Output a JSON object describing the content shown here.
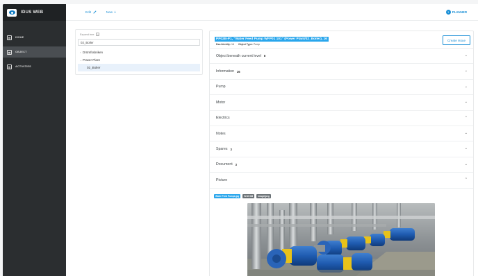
{
  "app": {
    "name": "IDUS WEB"
  },
  "sidebar": {
    "items": [
      {
        "label": "ISSUE",
        "icon": "document-icon",
        "active": false
      },
      {
        "label": "OBJECT",
        "icon": "object-icon",
        "active": true
      },
      {
        "label": "ACTIVITIES",
        "icon": "activities-icon",
        "active": false
      }
    ]
  },
  "topbar": {
    "edit_label": "Edit",
    "new_label": "New",
    "planner_label": "PLANNER"
  },
  "tree": {
    "expand_label": "Expand tree",
    "search_value": "02_Boiler",
    "nodes": [
      {
        "label": "Drömfrabriken",
        "caret": "›"
      },
      {
        "label": "Power Plant",
        "caret": "⌄"
      },
      {
        "label": "02_Boiler",
        "caret": ""
      }
    ]
  },
  "object": {
    "title": "PP02B-P1, \"Water Feed Pump WFP01 101\" (Power Plant/02_Boiler), 16",
    "identity_label": "Dsa Identity:",
    "identity_value": "16",
    "type_label": "Object Type:",
    "type_value": "Pump",
    "create_issue_label": "Create Issue"
  },
  "sections": [
    {
      "label": "Object beneath current level",
      "count": "8",
      "chevron": "⌄"
    },
    {
      "label": "Information",
      "count": "26",
      "chevron": "⌄"
    },
    {
      "label": "Pump",
      "count": "",
      "chevron": "⌄"
    },
    {
      "label": "Motor",
      "count": "",
      "chevron": "⌄"
    },
    {
      "label": "Electrics",
      "count": "",
      "chevron": "⌃"
    },
    {
      "label": "Notes",
      "count": "",
      "chevron": "⌄"
    },
    {
      "label": "Spares",
      "count": "3",
      "chevron": "⌄"
    },
    {
      "label": "Document",
      "count": "3",
      "chevron": "⌄"
    },
    {
      "label": "Picture",
      "count": "",
      "chevron": "⌃"
    }
  ],
  "picture": {
    "file_name": "Water Feed Pumps.jpg",
    "file_size": "92.26 kB",
    "mime": "image/jpeg"
  },
  "colors": {
    "accent": "#1a8fd6",
    "sidebar": "#2b2e30",
    "highlight": "#29a6ec"
  }
}
